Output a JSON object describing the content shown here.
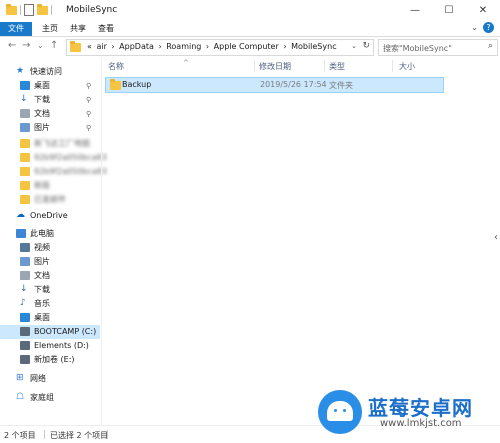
{
  "window": {
    "title": "MobileSync",
    "controls": {
      "minimize": "—",
      "maximize": "☐",
      "close": "✕"
    }
  },
  "ribbon": {
    "tabs": [
      "文件",
      "主页",
      "共享",
      "查看"
    ],
    "accent": "#1979ca",
    "expand_glyph": "⌄",
    "help_glyph": "?"
  },
  "address": {
    "back": "←",
    "forward": "→",
    "recent": "⌄",
    "up": "↑",
    "breadcrumbs": [
      "«",
      "air",
      "›",
      "AppData",
      "›",
      "Roaming",
      "›",
      "Apple Computer",
      "›",
      "MobileSync"
    ],
    "dropdown": "⌄",
    "refresh": "↻",
    "search_placeholder": "搜索\"MobileSync\"",
    "search_icon": "search-icon"
  },
  "nav": {
    "items": [
      {
        "label": "快速访问",
        "icon": "star-icon",
        "pinned": false,
        "blurred": false
      },
      {
        "label": "桌面",
        "icon": "desktop-icon",
        "pinned": true,
        "blurred": false
      },
      {
        "label": "下载",
        "icon": "download-icon",
        "pinned": true,
        "blurred": false
      },
      {
        "label": "文档",
        "icon": "document-icon",
        "pinned": true,
        "blurred": false
      },
      {
        "label": "图片",
        "icon": "picture-icon",
        "pinned": true,
        "blurred": false
      },
      {
        "label": "新飞达工厂地图",
        "icon": "folder-icon",
        "pinned": false,
        "blurred": true
      },
      {
        "label": "92b9f2a050bca83",
        "icon": "folder-icon",
        "pinned": false,
        "blurred": true
      },
      {
        "label": "92b9f2a050bca83",
        "icon": "folder-icon",
        "pinned": false,
        "blurred": true
      },
      {
        "label": "新版",
        "icon": "folder-icon",
        "pinned": false,
        "blurred": true
      },
      {
        "label": "已发邮件",
        "icon": "folder-icon",
        "pinned": false,
        "blurred": true
      },
      {
        "label": "OneDrive",
        "icon": "cloud-icon",
        "pinned": false,
        "blurred": false
      },
      {
        "label": "此电脑",
        "icon": "computer-icon",
        "pinned": false,
        "blurred": false
      },
      {
        "label": "视频",
        "icon": "video-icon",
        "pinned": false,
        "blurred": false
      },
      {
        "label": "图片",
        "icon": "picture-icon",
        "pinned": false,
        "blurred": false
      },
      {
        "label": "文档",
        "icon": "document-icon",
        "pinned": false,
        "blurred": false
      },
      {
        "label": "下载",
        "icon": "download-icon",
        "pinned": false,
        "blurred": false
      },
      {
        "label": "音乐",
        "icon": "music-icon",
        "pinned": false,
        "blurred": false
      },
      {
        "label": "桌面",
        "icon": "desktop-icon",
        "pinned": false,
        "blurred": false
      },
      {
        "label": "BOOTCAMP (C:)",
        "icon": "drive-icon",
        "pinned": false,
        "blurred": false,
        "selected": true
      },
      {
        "label": "Elements (D:)",
        "icon": "drive-icon",
        "pinned": false,
        "blurred": false
      },
      {
        "label": "新加卷 (E:)",
        "icon": "drive-icon",
        "pinned": false,
        "blurred": false
      },
      {
        "label": "网络",
        "icon": "network-icon",
        "pinned": false,
        "blurred": false
      },
      {
        "label": "家庭组",
        "icon": "homegroup-icon",
        "pinned": false,
        "blurred": false
      }
    ],
    "pin_glyph": "📌"
  },
  "list": {
    "columns": [
      "名称",
      "修改日期",
      "类型",
      "大小"
    ],
    "sort_glyph": "^",
    "rows": [
      {
        "name": "Backup",
        "date": "2019/5/26 17:54",
        "type": "文件夹",
        "size": ""
      }
    ]
  },
  "side_chevron": "‹",
  "status": {
    "count": "2 个项目",
    "selected": "已选择 2 个项目"
  },
  "watermark": {
    "text": "蓝莓安卓网",
    "url": "www.lmkjst.com",
    "color": "#1c6ec9"
  }
}
